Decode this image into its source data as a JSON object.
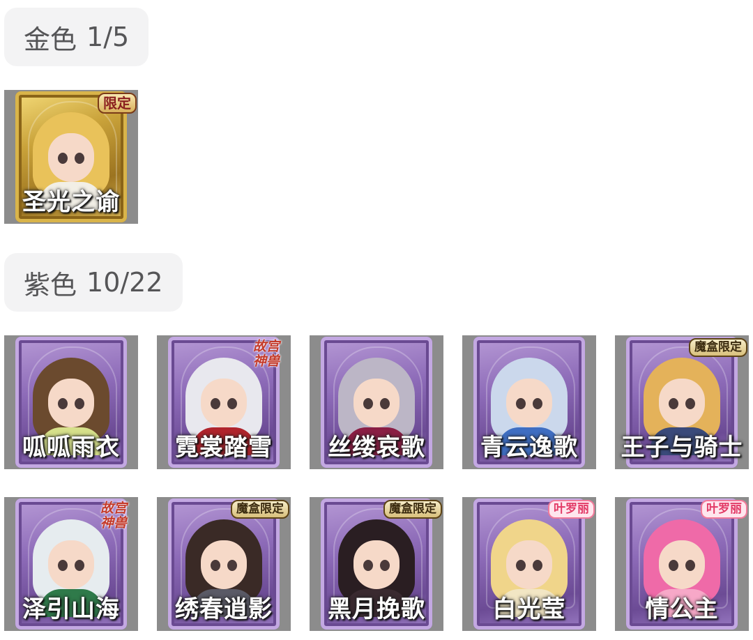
{
  "sections": [
    {
      "label": "金色",
      "count": "1/5",
      "items": [
        {
          "name": "圣光之谕",
          "badge": "限定",
          "badge_type": "limited",
          "hair": "#e9c25a",
          "outfit": "#f2efe6"
        }
      ]
    },
    {
      "label": "紫色",
      "count": "10/22",
      "items": [
        {
          "name": "呱呱雨衣",
          "badge": "",
          "badge_type": "none",
          "hair": "#6b4a2e",
          "outfit": "#d6e08a"
        },
        {
          "name": "霓裳踏雪",
          "badge": "故宫神兽",
          "badge_type": "palace",
          "hair": "#e8e8ee",
          "outfit": "#b0242c"
        },
        {
          "name": "丝缕哀歌",
          "badge": "",
          "badge_type": "none",
          "hair": "#bcb6c6",
          "outfit": "#8a1e44"
        },
        {
          "name": "青云逸歌",
          "badge": "",
          "badge_type": "none",
          "hair": "#cbd8ec",
          "outfit": "#3f6ec2"
        },
        {
          "name": "王子与骑士",
          "badge": "魔盒限定",
          "badge_type": "box",
          "hair": "#e4b25a",
          "outfit": "#3a4a7a"
        },
        {
          "name": "泽引山海",
          "badge": "故宫神兽",
          "badge_type": "palace",
          "hair": "#e6ecef",
          "outfit": "#2f7a4a"
        },
        {
          "name": "绣春逍影",
          "badge": "魔盒限定",
          "badge_type": "box",
          "hair": "#3a2a26",
          "outfit": "#5a5a66"
        },
        {
          "name": "黑月挽歌",
          "badge": "魔盒限定",
          "badge_type": "box",
          "hair": "#2a1e22",
          "outfit": "#3a2a30"
        },
        {
          "name": "白光莹",
          "badge": "叶罗丽",
          "badge_type": "yeluoli",
          "hair": "#f0d58a",
          "outfit": "#f2e6c4"
        },
        {
          "name": "情公主",
          "badge": "叶罗丽",
          "badge_type": "yeluoli",
          "hair": "#ef6aa8",
          "outfit": "#f7a8c8"
        }
      ]
    }
  ]
}
